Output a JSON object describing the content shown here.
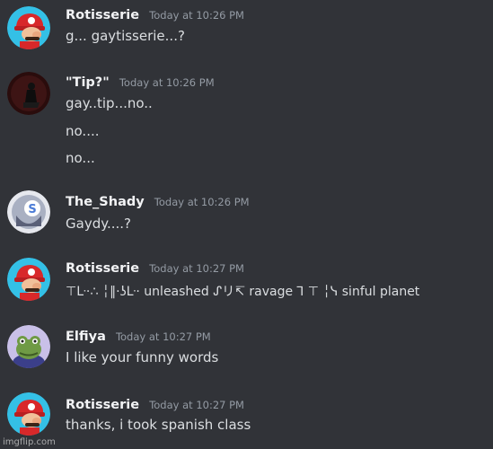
{
  "messages": [
    {
      "username": "Rotisserie",
      "timestamp": "Today at 10:26 PM",
      "avatar_icon": "mario-avatar-icon",
      "lines": [
        "g... gaytisserie...?"
      ]
    },
    {
      "username": "\"Tip?\"",
      "timestamp": "Today at 10:26 PM",
      "avatar_icon": "dark-figure-avatar-icon",
      "lines": [
        "gay..tip...no..",
        "no....",
        "no..."
      ]
    },
    {
      "username": "The_Shady",
      "timestamp": "Today at 10:26 PM",
      "avatar_icon": "shady-face-avatar-icon",
      "lines": [
        "Gaydy....?"
      ]
    },
    {
      "username": "Rotisserie",
      "timestamp": "Today at 10:27 PM",
      "avatar_icon": "mario-avatar-icon",
      "lines": [
        "⊤ᒷ·∴ ╎‖·ʖᒷ· unleashed ᔑリ↸ ravage ⅂ ⊤ ╎ᓭ sinful planet"
      ]
    },
    {
      "username": "Elfiya",
      "timestamp": "Today at 10:27 PM",
      "avatar_icon": "frog-avatar-icon",
      "lines": [
        "I like your funny words"
      ]
    },
    {
      "username": "Rotisserie",
      "timestamp": "Today at 10:27 PM",
      "avatar_icon": "mario-avatar-icon",
      "lines": [
        "thanks, i took spanish class"
      ]
    }
  ],
  "watermark": "imgflip.com",
  "colors": {
    "background": "#313338",
    "username": "#f2f3f5",
    "timestamp": "#949ba4",
    "message_text": "#dbdee1"
  }
}
